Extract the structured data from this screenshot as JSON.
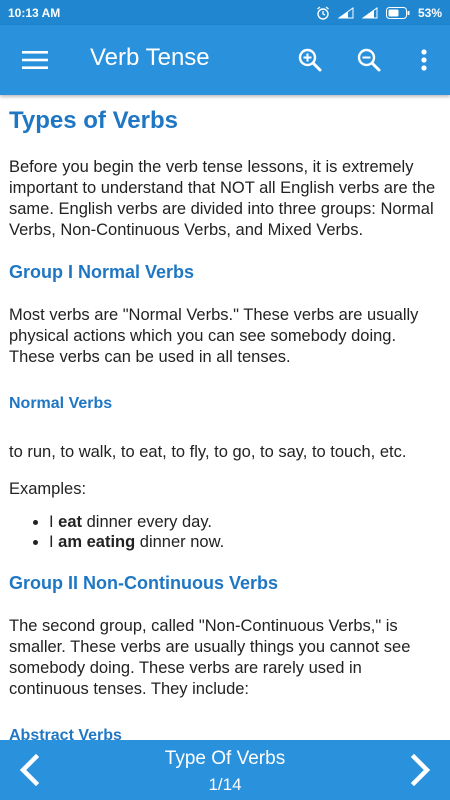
{
  "status_bar": {
    "time": "10:13 AM",
    "battery": "53%",
    "icons": [
      "alarm-icon",
      "signal-icon",
      "signal-icon-2",
      "battery-icon"
    ]
  },
  "app_bar": {
    "title": "Verb Tense",
    "icons": [
      "menu-icon",
      "zoom-in-icon",
      "zoom-out-icon",
      "more-vert-icon"
    ]
  },
  "article": {
    "title": "Types of Verbs",
    "intro": "Before you begin the verb tense lessons, it is extremely important to understand that NOT all English verbs are the same. English verbs are divided into three groups: Normal Verbs, Non-Continuous Verbs, and Mixed Verbs.",
    "group1_heading": "Group I Normal Verbs",
    "group1_text": "Most verbs are \"Normal Verbs.\" These verbs are usually physical actions which you can see somebody doing. These verbs can be used in all tenses.",
    "normal_verbs_heading": "Normal Verbs",
    "normal_verbs_list": "to run, to walk, to eat, to fly, to go, to say, to touch, etc.",
    "examples_label": "Examples:",
    "example1": {
      "prefix": "I ",
      "bold": "eat",
      "suffix": " dinner every day."
    },
    "example2": {
      "prefix": "I ",
      "bold": "am eating",
      "suffix": " dinner now."
    },
    "group2_heading": "Group II Non-Continuous Verbs",
    "group2_text": "The second group, called \"Non-Continuous Verbs,\" is smaller. These verbs are usually things you cannot see somebody doing. These verbs are rarely used in continuous tenses. They include:",
    "abstract_verbs_heading": "Abstract Verbs"
  },
  "bottom_bar": {
    "chapter_title": "Type Of Verbs",
    "page_indicator": "1/14",
    "icons": [
      "chevron-left-icon",
      "chevron-right-icon"
    ]
  },
  "colors": {
    "primary": "#2a91dc",
    "status_bar": "#1f86cf",
    "heading": "#1f77c4"
  }
}
